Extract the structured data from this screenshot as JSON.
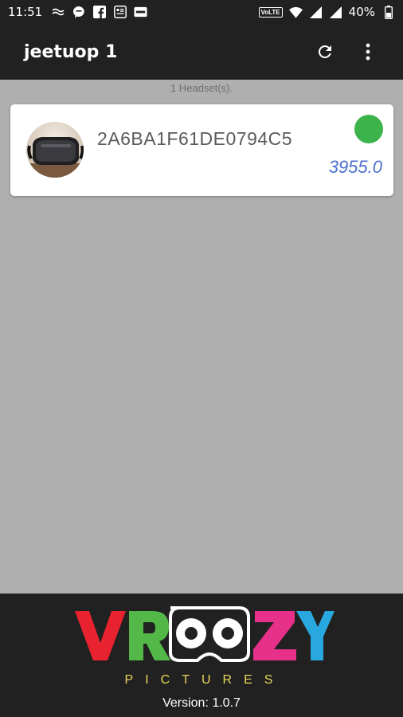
{
  "status_bar": {
    "time": "11:51",
    "network_badge": "VoLTE",
    "battery": "40%"
  },
  "toolbar": {
    "title": "jeetuop 1"
  },
  "headset_count": "1 Headset(s).",
  "devices": [
    {
      "id": "2A6BA1F61DE0794C5",
      "value": "3955.0",
      "status_color": "#3cb44b"
    }
  ],
  "footer": {
    "logo_text": "VROOZY",
    "logo_subtitle": "PICTURES",
    "version": "Version: 1.0.7"
  },
  "colors": {
    "app_bar": "#212121",
    "background": "#b0afb0",
    "value_text": "#4b6fd1",
    "online": "#3cb44b"
  }
}
